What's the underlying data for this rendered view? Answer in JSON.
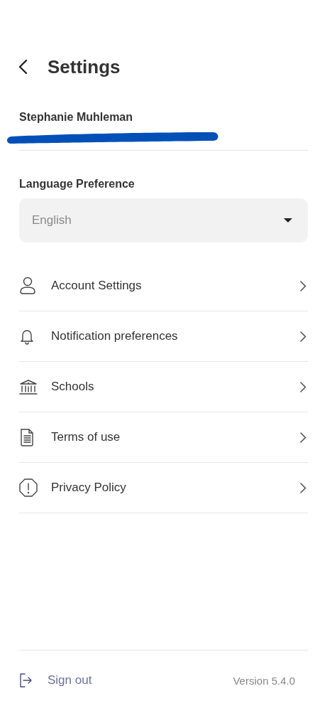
{
  "header": {
    "title": "Settings"
  },
  "profile": {
    "name": "Stephanie Muhleman"
  },
  "language": {
    "label": "Language Preference",
    "value": "English"
  },
  "menu": [
    {
      "kind": "person",
      "label": "Account Settings"
    },
    {
      "kind": "bell",
      "label": "Notification preferences"
    },
    {
      "kind": "school",
      "label": "Schools"
    },
    {
      "kind": "document",
      "label": "Terms of use"
    },
    {
      "kind": "alert",
      "label": "Privacy Policy"
    }
  ],
  "footer": {
    "sign_out": "Sign out",
    "version": "Version 5.4.0"
  }
}
